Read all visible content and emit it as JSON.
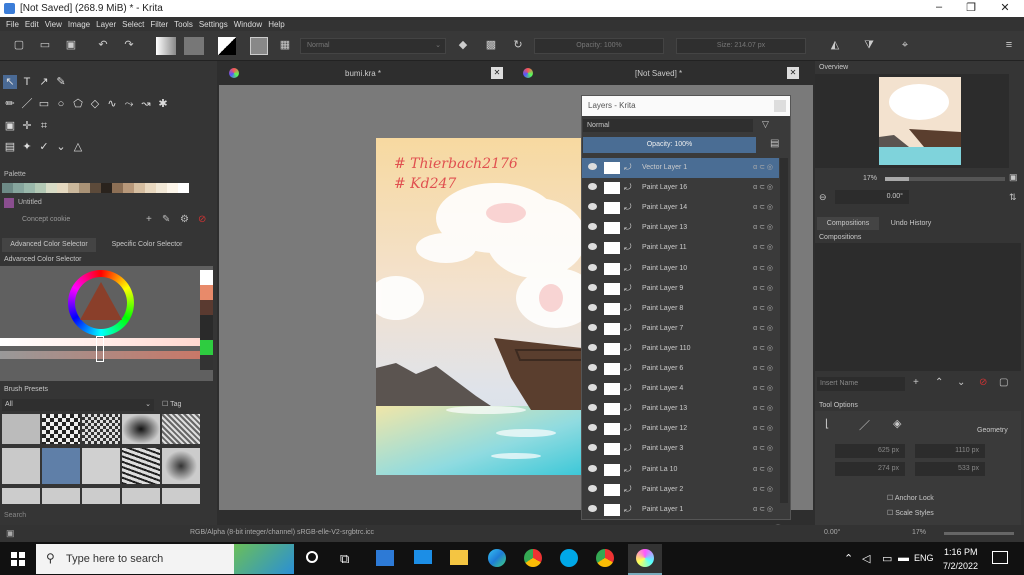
{
  "window": {
    "title": "[Not Saved]  (268.9 MiB)  * - Krita",
    "minimize": "–",
    "maximize": "❐",
    "close": "✕"
  },
  "menu": [
    "File",
    "Edit",
    "View",
    "Image",
    "Layer",
    "Select",
    "Filter",
    "Tools",
    "Settings",
    "Window",
    "Help"
  ],
  "toolbar": {
    "blend_mode": "Normal",
    "opacity": "Opacity: 100%",
    "size": "Size: 214.07 px"
  },
  "tabs": [
    {
      "label": "bumi.kra *"
    },
    {
      "label": "[Not Saved]  *"
    }
  ],
  "left": {
    "palette_title": "Palette",
    "palette_name": "Untitled",
    "color_name_placeholder": "Concept cookie",
    "tab_advanced": "Advanced Color Selector",
    "tab_specific": "Specific Color Selector",
    "adv_title": "Advanced Color Selector",
    "brush_title": "Brush Presets",
    "brush_filter": "All",
    "tag_label": "Tag",
    "search": "Search"
  },
  "painting": {
    "line1": "# Thierbach2176",
    "line2": "# Kd247"
  },
  "layers": {
    "title": "Layers - Krita",
    "blend": "Normal",
    "opacity": "Opacity:  100%",
    "items": [
      {
        "name": "Vector Layer 1",
        "selected": true
      },
      {
        "name": "Paint Layer 16"
      },
      {
        "name": "Paint Layer 14"
      },
      {
        "name": "Paint Layer 13"
      },
      {
        "name": "Paint Layer 11"
      },
      {
        "name": "Paint Layer 10"
      },
      {
        "name": "Paint Layer 9"
      },
      {
        "name": "Paint Layer 8"
      },
      {
        "name": "Paint Layer 7"
      },
      {
        "name": "Paint Layer 110"
      },
      {
        "name": "Paint Layer 6"
      },
      {
        "name": "Paint Layer 4"
      },
      {
        "name": "Paint Layer 13"
      },
      {
        "name": "Paint Layer 12"
      },
      {
        "name": "Paint Layer 3"
      },
      {
        "name": "Paint La  10"
      },
      {
        "name": "Paint Layer 2"
      },
      {
        "name": "Paint Layer 1"
      }
    ]
  },
  "right": {
    "overview_title": "Overview",
    "zoom": "17%",
    "rotation": "0.00°",
    "tab_compositions": "Compositions",
    "tab_undo": "Undo History",
    "compositions_title": "Compositions",
    "insert_name": "Insert Name",
    "tool_options": "Tool Options",
    "geometry": "Geometry",
    "x_val": "625 px",
    "y_val": "274 px",
    "w_val": "1110 px",
    "h_val": "533 px",
    "anchor_lock": "Anchor Lock",
    "scale_styles": "Scale Styles"
  },
  "status": {
    "colorspace": "RGB/Alpha (8-bit integer/channel)  sRGB-elle-V2-srgbtrc.icc",
    "rotation": "0.00°",
    "zoom": "17%"
  },
  "taskbar": {
    "search_placeholder": "Type here to search",
    "lang": "ENG",
    "time": "1:16 PM",
    "date": "7/2/2022"
  }
}
